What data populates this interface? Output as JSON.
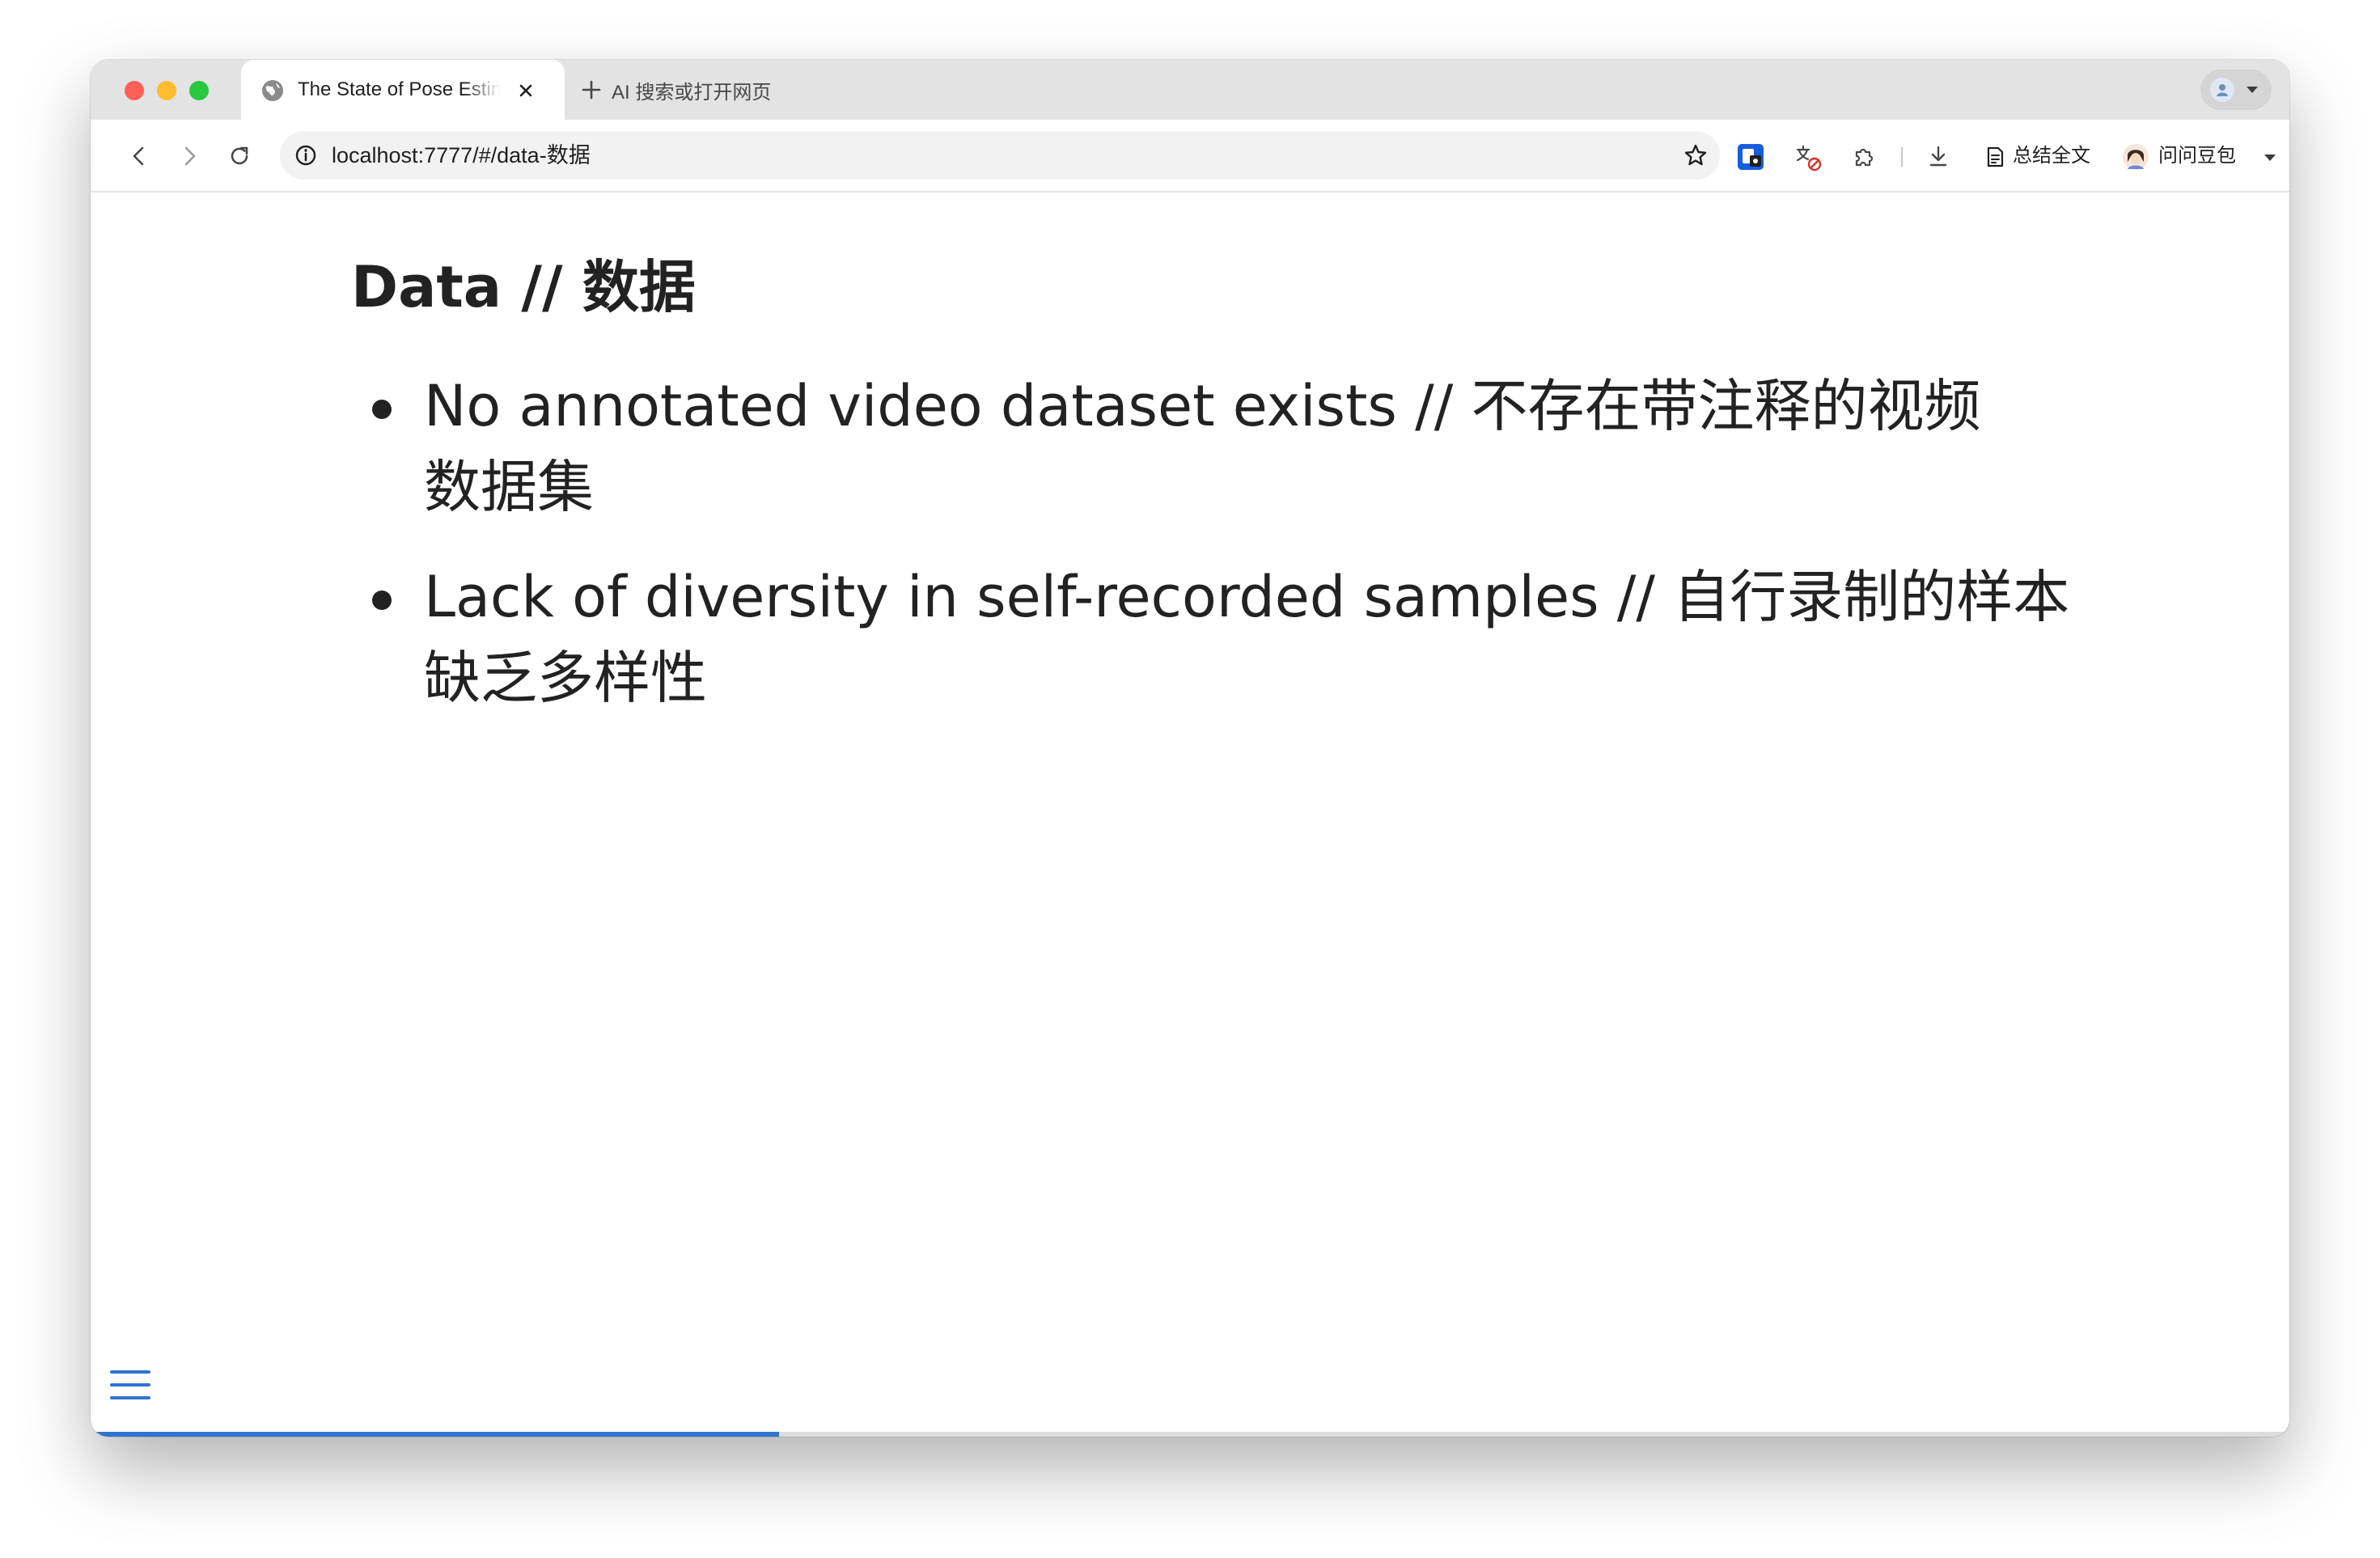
{
  "browser": {
    "tab": {
      "title": "The State of Pose Estimation"
    },
    "new_tab_label": "AI 搜索或打开网页",
    "omnibox": {
      "url": "localhost:7777/#/data-数据"
    },
    "toolbar": {
      "summarize_label": "总结全文",
      "assistant_label": "问问豆包"
    }
  },
  "slide": {
    "title": "Data // 数据",
    "bullets": [
      {
        "line1": "No annotated video dataset exists // 不存在带注释的视频",
        "line2": "数据集"
      },
      {
        "line1": "Lack of diversity in self-recorded samples // 自行录制的样本",
        "line2": "缺乏多样性"
      }
    ]
  },
  "presentation": {
    "progress": 0.313
  },
  "colors": {
    "accent": "#2f74d0",
    "text": "#222222"
  }
}
